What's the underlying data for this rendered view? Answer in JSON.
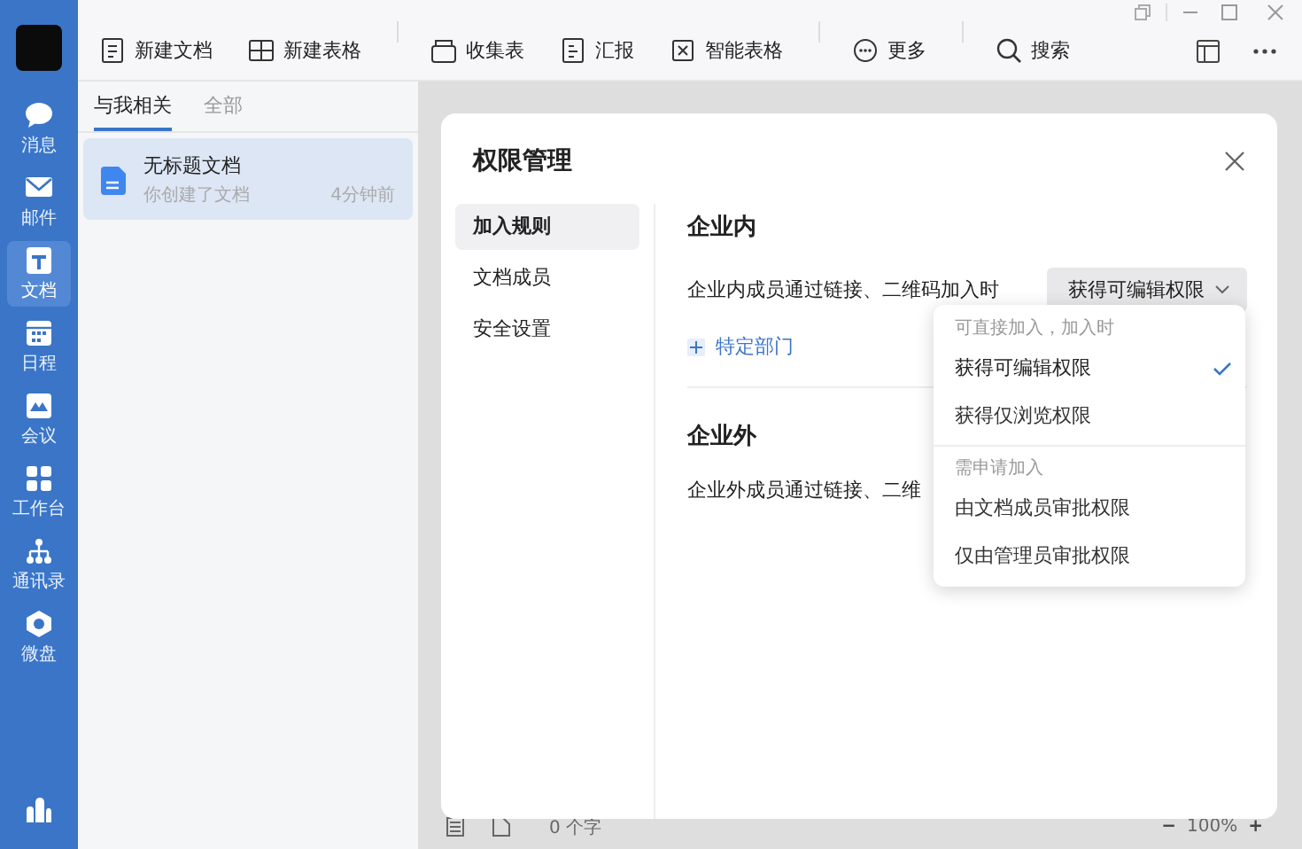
{
  "nav": [
    {
      "label": "消息",
      "selected": false
    },
    {
      "label": "邮件",
      "selected": false
    },
    {
      "label": "文档",
      "selected": true
    },
    {
      "label": "日程",
      "selected": false
    },
    {
      "label": "会议",
      "selected": false
    },
    {
      "label": "工作台",
      "selected": false
    },
    {
      "label": "通讯录",
      "selected": false
    },
    {
      "label": "微盘",
      "selected": false
    }
  ],
  "toolbar": [
    {
      "label": "新建文档"
    },
    {
      "label": "新建表格"
    },
    {
      "label": "收集表"
    },
    {
      "label": "汇报"
    },
    {
      "label": "智能表格"
    },
    {
      "label": "更多"
    },
    {
      "label": "搜索"
    }
  ],
  "list_tabs": [
    {
      "label": "与我相关",
      "selected": true
    },
    {
      "label": "全部",
      "selected": false
    }
  ],
  "documents": [
    {
      "title": "无标题文档",
      "subtitle": "你创建了文档",
      "time": "4分钟前",
      "selected": true
    }
  ],
  "dialog": {
    "title": "权限管理",
    "menu": [
      {
        "label": "加入规则",
        "selected": true
      },
      {
        "label": "文档成员",
        "selected": false
      },
      {
        "label": "安全设置",
        "selected": false
      }
    ],
    "sections": [
      {
        "heading": "企业内",
        "rule": "企业内成员通过链接、二维码加入时",
        "value": "获得可编辑权限",
        "link": "特定部门"
      },
      {
        "heading": "企业外",
        "rule": "企业外成员通过链接、二维"
      }
    ]
  },
  "dropdown": {
    "groups": [
      {
        "heading": "可直接加入，加入时",
        "options": [
          {
            "label": "获得可编辑权限",
            "selected": true
          },
          {
            "label": "获得仅浏览权限",
            "selected": false
          }
        ]
      },
      {
        "heading": "需申请加入",
        "options": [
          {
            "label": "由文档成员审批权限",
            "selected": false
          },
          {
            "label": "仅由管理员审批权限",
            "selected": false
          }
        ]
      }
    ]
  },
  "status_bar": {
    "word_count": "0 个字",
    "zoom_out": "−",
    "zoom": "100%",
    "zoom_in": "+"
  }
}
